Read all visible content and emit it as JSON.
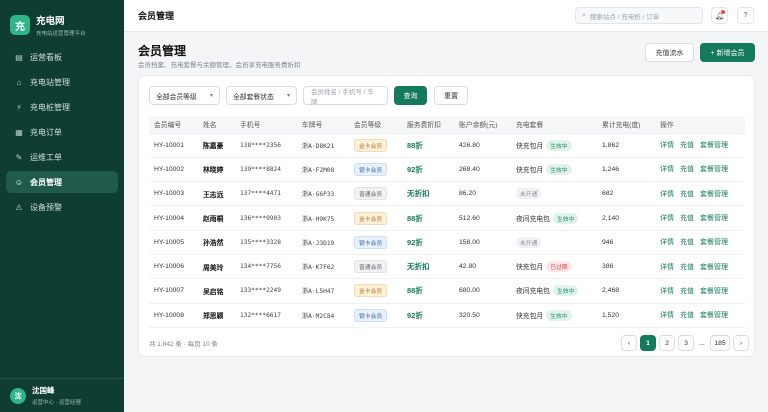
{
  "brand": {
    "logo": "充",
    "name": "充电网",
    "subtitle": "充电站运营管理平台"
  },
  "nav": [
    {
      "icon": "▤",
      "icon_name": "dashboard-icon",
      "label": "运营看板"
    },
    {
      "icon": "⌂",
      "icon_name": "station-icon",
      "label": "充电站管理"
    },
    {
      "icon": "⚡",
      "icon_name": "charger-icon",
      "label": "充电桩管理"
    },
    {
      "icon": "▦",
      "icon_name": "order-icon",
      "label": "充电订单"
    },
    {
      "icon": "✎",
      "icon_name": "ticket-icon",
      "label": "运维工单"
    },
    {
      "icon": "☺",
      "icon_name": "member-icon",
      "label": "会员管理"
    },
    {
      "icon": "⚠",
      "icon_name": "alert-icon",
      "label": "设备预警"
    }
  ],
  "user": {
    "avatar": "沈",
    "name": "沈国峰",
    "role": "运营中心 · 运营经理"
  },
  "topbar": {
    "title": "会员管理",
    "search_placeholder": "搜索站点 / 充电桩 / 订单",
    "bell_icon": "bell-icon",
    "help_label": "?"
  },
  "page": {
    "title": "会员管理",
    "subtitle": "会员档案、充电套餐与余额管理，会员享充电服务费折扣",
    "recharge_label": "充值流水",
    "add_label": "+ 新增会员"
  },
  "filters": {
    "level": "全部会员等级",
    "plan_status": "全部套餐状态",
    "keyword_placeholder": "会员姓名 / 手机号 / 车牌",
    "query_label": "查询",
    "reset_label": "重置"
  },
  "table": {
    "headers": [
      "会员编号",
      "姓名",
      "手机号",
      "车牌号",
      "会员等级",
      "服务费折扣",
      "账户余额(元)",
      "充电套餐",
      "累计充电(度)",
      "操作"
    ],
    "rows": [
      {
        "id": "HY-10001",
        "name": "陈嘉豪",
        "phone": "138****2356",
        "plate": "浙A·D8K21",
        "level": "金卡会员",
        "level_type": "gold",
        "discount": "88折",
        "balance": "426.80",
        "plan": "快充包月",
        "plan_status": "生效中",
        "status_type": "on",
        "kwh": "1,862"
      },
      {
        "id": "HY-10002",
        "name": "林晓婷",
        "phone": "139****8824",
        "plate": "浙A·F2M08",
        "level": "银卡会员",
        "level_type": "silver",
        "discount": "92折",
        "balance": "268.40",
        "plan": "快充包月",
        "plan_status": "生效中",
        "status_type": "on",
        "kwh": "1,246"
      },
      {
        "id": "HY-10003",
        "name": "王志远",
        "phone": "137****4471",
        "plate": "浙A·G6P33",
        "level": "普通会员",
        "level_type": "normal",
        "discount": "无折扣",
        "balance": "86.20",
        "plan": "",
        "plan_status": "未开通",
        "status_type": "off",
        "kwh": "682"
      },
      {
        "id": "HY-10004",
        "name": "赵雨桐",
        "phone": "136****9903",
        "plate": "浙A·H9K75",
        "level": "金卡会员",
        "level_type": "gold",
        "discount": "88折",
        "balance": "512.60",
        "plan": "夜间充电包",
        "plan_status": "生效中",
        "status_type": "on",
        "kwh": "2,140"
      },
      {
        "id": "HY-10005",
        "name": "孙浩然",
        "phone": "135****3328",
        "plate": "浙A·J3D19",
        "level": "银卡会员",
        "level_type": "silver",
        "discount": "92折",
        "balance": "158.00",
        "plan": "",
        "plan_status": "未开通",
        "status_type": "off",
        "kwh": "946"
      },
      {
        "id": "HY-10006",
        "name": "周美玲",
        "phone": "134****7756",
        "plate": "浙A·K7F62",
        "level": "普通会员",
        "level_type": "normal",
        "discount": "无折扣",
        "balance": "42.80",
        "plan": "快充包月",
        "plan_status": "已过期",
        "status_type": "exp",
        "kwh": "386"
      },
      {
        "id": "HY-10007",
        "name": "吴启铭",
        "phone": "133****2249",
        "plate": "浙A·L5H47",
        "level": "金卡会员",
        "level_type": "gold",
        "discount": "88折",
        "balance": "680.00",
        "plan": "夜间充电包",
        "plan_status": "生效中",
        "status_type": "on",
        "kwh": "2,468"
      },
      {
        "id": "HY-10008",
        "name": "郑思颖",
        "phone": "132****6617",
        "plate": "浙A·M2C84",
        "level": "银卡会员",
        "level_type": "silver",
        "discount": "92折",
        "balance": "320.50",
        "plan": "快充包月",
        "plan_status": "生效中",
        "status_type": "on",
        "kwh": "1,520"
      }
    ],
    "actions": [
      "详情",
      "充值",
      "套餐管理"
    ]
  },
  "pagination": {
    "total_text": "共 1,842 条 · 每页 10 条",
    "prev": "‹",
    "pages": [
      "1",
      "2",
      "3"
    ],
    "ellipsis": "...",
    "last": "185",
    "next": "›",
    "current": "1"
  },
  "colors": {
    "sidebar": "#0f3d32",
    "primary": "#157a5c",
    "accent": "#2fb389"
  }
}
